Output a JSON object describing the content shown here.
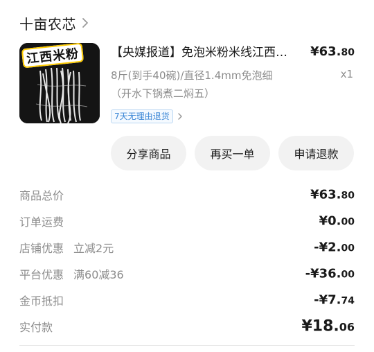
{
  "store": {
    "name": "十亩农芯"
  },
  "product": {
    "thumb_text": "江西米粉",
    "title": "【央媒报道】免泡米粉米线江西…",
    "price_main": "¥63.",
    "price_cents": "80",
    "spec": "8斤(到手40碗)/直径1.4mm免泡细（开水下锅煮二焖五）",
    "quantity": "x1",
    "return_badge": "7天无理由退货"
  },
  "buttons": {
    "share": "分享商品",
    "rebuy": "再买一单",
    "refund": "申请退款"
  },
  "summary": {
    "rows": [
      {
        "label": "商品总价",
        "sub": "",
        "main": "¥63.",
        "cents": "80"
      },
      {
        "label": "订单运费",
        "sub": "",
        "main": "¥0.",
        "cents": "00"
      },
      {
        "label": "店铺优惠",
        "sub": "立减2元",
        "main": "-¥2.",
        "cents": "00"
      },
      {
        "label": "平台优惠",
        "sub": "满60减36",
        "main": "-¥36.",
        "cents": "00"
      },
      {
        "label": "金币抵扣",
        "sub": "",
        "main": "-¥7.",
        "cents": "74"
      }
    ],
    "total": {
      "label": "实付款",
      "main": "¥18.",
      "cents": "06"
    }
  },
  "icons": {
    "store_chevron": "chevron-right-icon",
    "return_chevron": "chevron-right-icon"
  },
  "colors": {
    "return_badge": "#3a86d6",
    "button_bg": "#f2f2f2",
    "secondary_text": "#8c8c8c"
  }
}
